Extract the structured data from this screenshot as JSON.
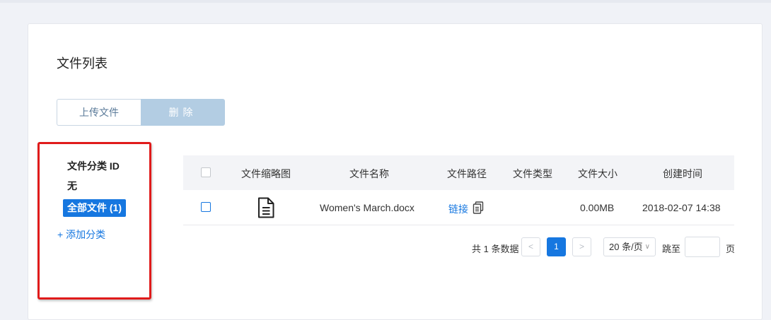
{
  "page": {
    "title": "文件列表"
  },
  "toolbar": {
    "upload_label": "上传文件",
    "delete_label": "删除"
  },
  "sidebar": {
    "category_id_label": "文件分类 ID",
    "none_label": "无",
    "all_files_label": "全部文件 (1)",
    "add_category_label": "+ 添加分类"
  },
  "table": {
    "headers": [
      "文件缩略图",
      "文件名称",
      "文件路径",
      "文件类型",
      "文件大小",
      "创建时间"
    ],
    "rows": [
      {
        "thumbnail_icon": "document-icon",
        "name": "Women's March.docx",
        "path_label": "链接",
        "path_icon": "copy-icon",
        "type": "",
        "size": "0.00MB",
        "created": "2018-02-07 14:38"
      }
    ]
  },
  "pagination": {
    "total_text": "共 1 条数据",
    "prev": "<",
    "current_page": "1",
    "next": ">",
    "page_size": "20 条/页",
    "jump_label": "跳至",
    "page_suffix": "页"
  },
  "colors": {
    "accent": "#1677e0",
    "highlight_frame": "#e01b1b",
    "delete_button": "#b3cde3"
  }
}
